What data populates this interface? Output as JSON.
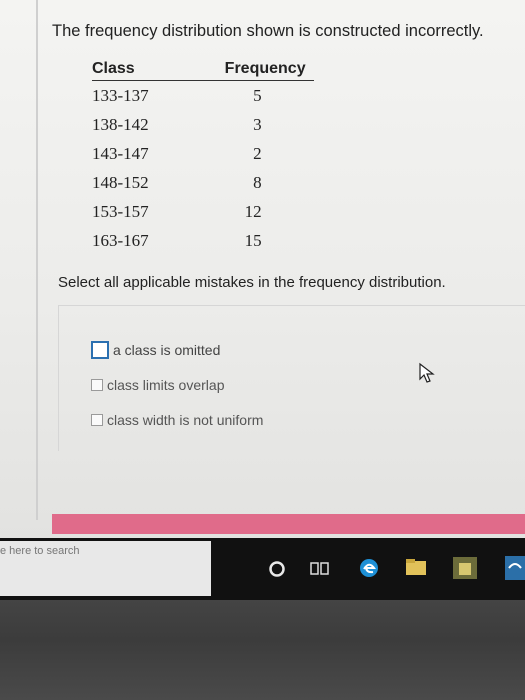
{
  "question": "The frequency distribution shown is constructed incorrectly.",
  "table": {
    "headers": [
      "Class",
      "Frequency"
    ],
    "rows": [
      {
        "class": "133-137",
        "frequency": "5"
      },
      {
        "class": "138-142",
        "frequency": "3"
      },
      {
        "class": "143-147",
        "frequency": "2"
      },
      {
        "class": "148-152",
        "frequency": "8"
      },
      {
        "class": "153-157",
        "frequency": "12"
      },
      {
        "class": "163-167",
        "frequency": "15"
      }
    ]
  },
  "instruction": "Select all applicable mistakes in the frequency distribution.",
  "options": [
    {
      "label": "a class is omitted",
      "checked": false
    },
    {
      "label": "class limits overlap",
      "checked": false
    },
    {
      "label": "class width is not uniform",
      "checked": false
    }
  ],
  "taskbar": {
    "search_placeholder": "e here to search",
    "icons": [
      "cortana-circle-icon",
      "task-view-icon",
      "edge-icon",
      "file-explorer-icon",
      "store-icon",
      "app-icon"
    ]
  },
  "colors": {
    "accent_bar": "#e06b8a",
    "focus_border": "#2a6fb0",
    "edge_blue": "#1e90d6",
    "taskbar_bg": "#111111"
  }
}
